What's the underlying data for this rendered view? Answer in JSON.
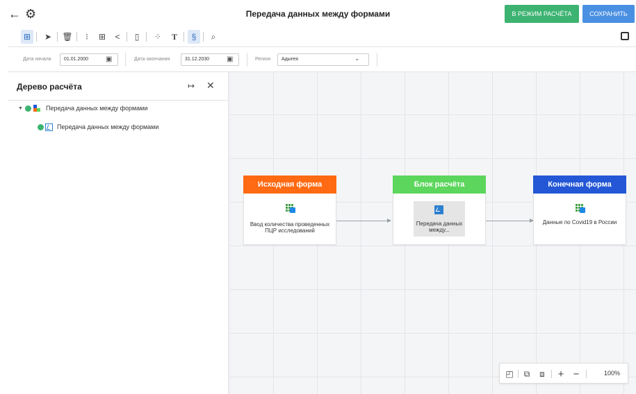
{
  "header": {
    "title": "Передача данных между формами",
    "calc_mode_button": "В РЕЖИМ РАСЧЁТА",
    "save_button": "СОХРАНИТЬ",
    "back_icon": "arrow-left-icon",
    "settings_icon": "gear-icon"
  },
  "filters": {
    "start_label": "Дата начала",
    "start_value": "01.01.2000",
    "end_label": "Дата окончания",
    "end_value": "31.12.2030",
    "region_label": "Регион",
    "region_value": "Адыгея"
  },
  "tree_panel": {
    "title": "Дерево расчёта",
    "items": [
      {
        "label": "Передача данных между формами"
      },
      {
        "label": "Передача данных между формами"
      }
    ]
  },
  "diagram": {
    "nodes": [
      {
        "header": "Исходная форма",
        "text": "Ввод количества проведенных ПЦР исследований",
        "color": "#ff6a13"
      },
      {
        "header": "Блок расчёта",
        "text": "Передача данных между...",
        "color": "#5cd65c"
      },
      {
        "header": "Конечная форма",
        "text": "Данные по Covid19 в России",
        "color": "#2357d6"
      }
    ]
  },
  "zoom": {
    "value": "100%"
  },
  "colors": {
    "calc_button": "#3cb371",
    "save_button": "#4a90e2",
    "active_tool": "#dde8f7"
  }
}
